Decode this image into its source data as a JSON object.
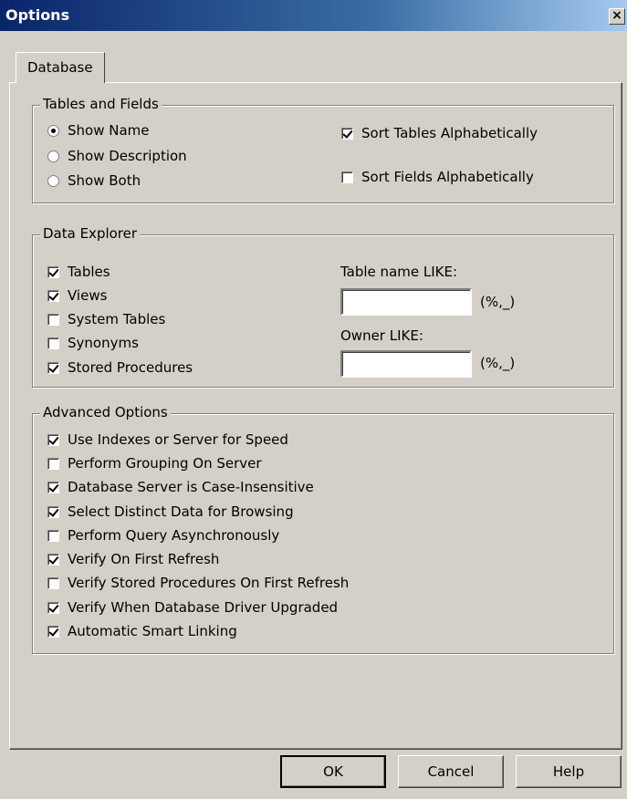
{
  "window": {
    "title": "Options",
    "close_glyph": "×"
  },
  "tabs": [
    "Database"
  ],
  "tables_fields": {
    "legend": "Tables and Fields",
    "radios": [
      {
        "label": "Show Name",
        "checked": true
      },
      {
        "label": "Show Description",
        "checked": false
      },
      {
        "label": "Show Both",
        "checked": false
      }
    ],
    "checks": [
      {
        "label": "Sort Tables Alphabetically",
        "checked": true
      },
      {
        "label": "Sort Fields Alphabetically",
        "checked": false
      }
    ]
  },
  "data_explorer": {
    "legend": "Data Explorer",
    "checks": [
      {
        "label": "Tables",
        "checked": true
      },
      {
        "label": "Views",
        "checked": true
      },
      {
        "label": "System Tables",
        "checked": false
      },
      {
        "label": "Synonyms",
        "checked": false
      },
      {
        "label": "Stored Procedures",
        "checked": true
      }
    ],
    "table_name_label": "Table name LIKE:",
    "table_name_value": "",
    "table_name_hint": "(%,_)",
    "owner_label": "Owner LIKE:",
    "owner_value": "",
    "owner_hint": "(%,_)"
  },
  "advanced": {
    "legend": "Advanced Options",
    "checks": [
      {
        "label": "Use Indexes or Server for Speed",
        "checked": true
      },
      {
        "label": "Perform Grouping On Server",
        "checked": false
      },
      {
        "label": "Database Server is Case-Insensitive",
        "checked": true
      },
      {
        "label": "Select Distinct Data for Browsing",
        "checked": true
      },
      {
        "label": "Perform Query Asynchronously",
        "checked": false
      },
      {
        "label": "Verify On First Refresh",
        "checked": true
      },
      {
        "label": "Verify Stored Procedures On First Refresh",
        "checked": false
      },
      {
        "label": "Verify When Database Driver Upgraded",
        "checked": true
      },
      {
        "label": "Automatic Smart Linking",
        "checked": true
      }
    ]
  },
  "buttons": {
    "ok": "OK",
    "cancel": "Cancel",
    "help": "Help"
  }
}
